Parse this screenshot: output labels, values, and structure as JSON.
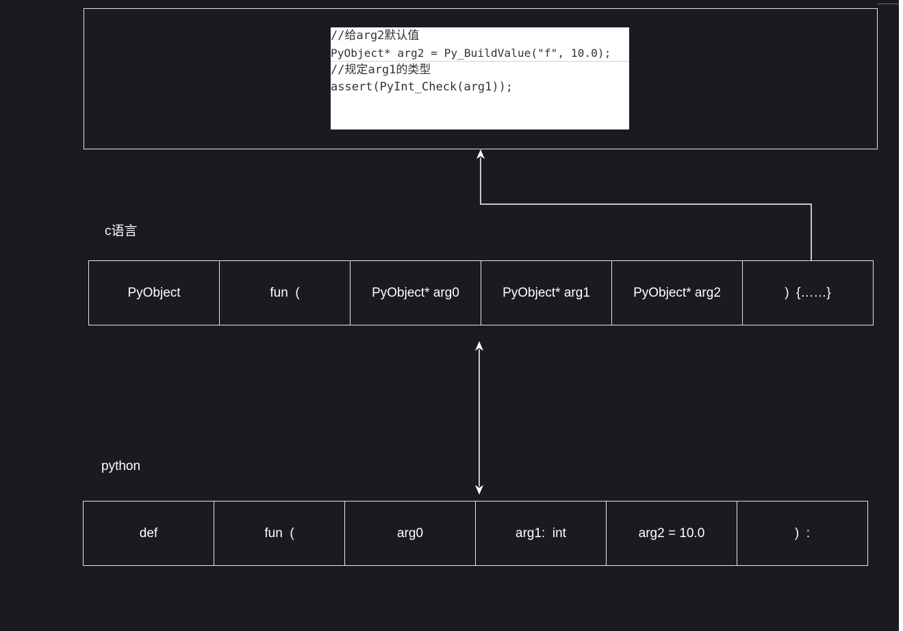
{
  "code": {
    "lines": [
      "//给arg2默认值",
      "PyObject* arg2 = Py_BuildValue(\"f\", 10.0);",
      "//规定arg1的类型",
      "assert(PyInt_Check(arg1));"
    ]
  },
  "c_section": {
    "label": "c语言",
    "cells": [
      "PyObject",
      "fun  (",
      "PyObject* arg0",
      "PyObject* arg1",
      "PyObject* arg2",
      ")  {……}"
    ]
  },
  "python_section": {
    "label": "python",
    "cells": [
      "def",
      "fun  (",
      "arg0",
      "arg1:  int",
      "arg2 = 10.0",
      ")  :"
    ]
  },
  "colors": {
    "background": "#1b1a20",
    "stroke": "#e6e6e6",
    "code_bg": "#ffffff",
    "code_text": "#333333"
  }
}
